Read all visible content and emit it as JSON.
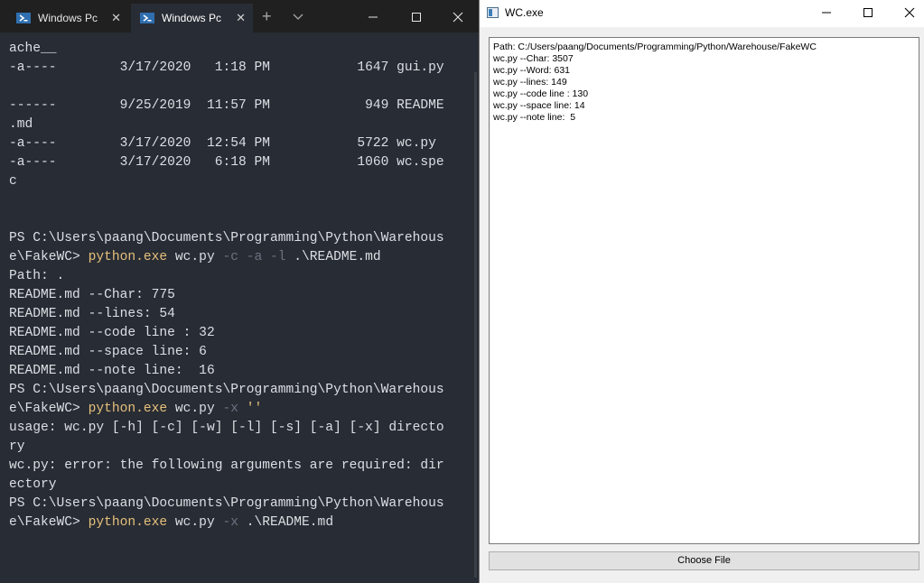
{
  "terminal": {
    "tabs": [
      {
        "label": "Windows Pc",
        "active": false
      },
      {
        "label": "Windows Pc",
        "active": true
      }
    ],
    "lines": [
      [
        {
          "t": "ache__"
        }
      ],
      [
        {
          "t": "-a----        3/17/2020   1:18 PM           1647 gui.py"
        }
      ],
      [
        {
          "t": ""
        }
      ],
      [
        {
          "t": "------        9/25/2019  11:57 PM            949 README"
        }
      ],
      [
        {
          "t": ".md"
        }
      ],
      [
        {
          "t": "-a----        3/17/2020  12:54 PM           5722 wc.py"
        }
      ],
      [
        {
          "t": "-a----        3/17/2020   6:18 PM           1060 wc.spe"
        }
      ],
      [
        {
          "t": "c"
        }
      ],
      [
        {
          "t": ""
        }
      ],
      [
        {
          "t": ""
        }
      ],
      [
        {
          "t": "PS C:\\Users\\paang\\Documents\\Programming\\Python\\Warehous"
        }
      ],
      [
        {
          "t": "e\\FakeWC> "
        },
        {
          "t": "python.exe",
          "c": "hl"
        },
        {
          "t": " wc.py "
        },
        {
          "t": "-c -a -l",
          "c": "dim"
        },
        {
          "t": " .\\README.md"
        }
      ],
      [
        {
          "t": "Path: ."
        }
      ],
      [
        {
          "t": "README.md --Char: 775"
        }
      ],
      [
        {
          "t": "README.md --lines: 54"
        }
      ],
      [
        {
          "t": "README.md --code line : 32"
        }
      ],
      [
        {
          "t": "README.md --space line: 6"
        }
      ],
      [
        {
          "t": "README.md --note line:  16"
        }
      ],
      [
        {
          "t": "PS C:\\Users\\paang\\Documents\\Programming\\Python\\Warehous"
        }
      ],
      [
        {
          "t": "e\\FakeWC> "
        },
        {
          "t": "python.exe",
          "c": "hl"
        },
        {
          "t": " wc.py "
        },
        {
          "t": "-x",
          "c": "dim"
        },
        {
          "t": " "
        },
        {
          "t": "''",
          "c": "hl"
        }
      ],
      [
        {
          "t": "usage: wc.py [-h] [-c] [-w] [-l] [-s] [-a] [-x] directo"
        }
      ],
      [
        {
          "t": "ry"
        }
      ],
      [
        {
          "t": "wc.py: error: the following arguments are required: dir"
        }
      ],
      [
        {
          "t": "ectory"
        }
      ],
      [
        {
          "t": "PS C:\\Users\\paang\\Documents\\Programming\\Python\\Warehous"
        }
      ],
      [
        {
          "t": "e\\FakeWC> "
        },
        {
          "t": "python.exe",
          "c": "hl"
        },
        {
          "t": " wc.py "
        },
        {
          "t": "-x",
          "c": "dim"
        },
        {
          "t": " .\\README.md"
        }
      ]
    ]
  },
  "wc_window": {
    "title": "WC.exe",
    "output_lines": [
      "Path: C:/Users/paang/Documents/Programming/Python/Warehouse/FakeWC",
      "wc.py --Char: 3507",
      "wc.py --Word: 631",
      "wc.py --lines: 149",
      "wc.py --code line : 130",
      "wc.py --space line: 14",
      "wc.py --note line:  5"
    ],
    "choose_button_label": "Choose File"
  }
}
